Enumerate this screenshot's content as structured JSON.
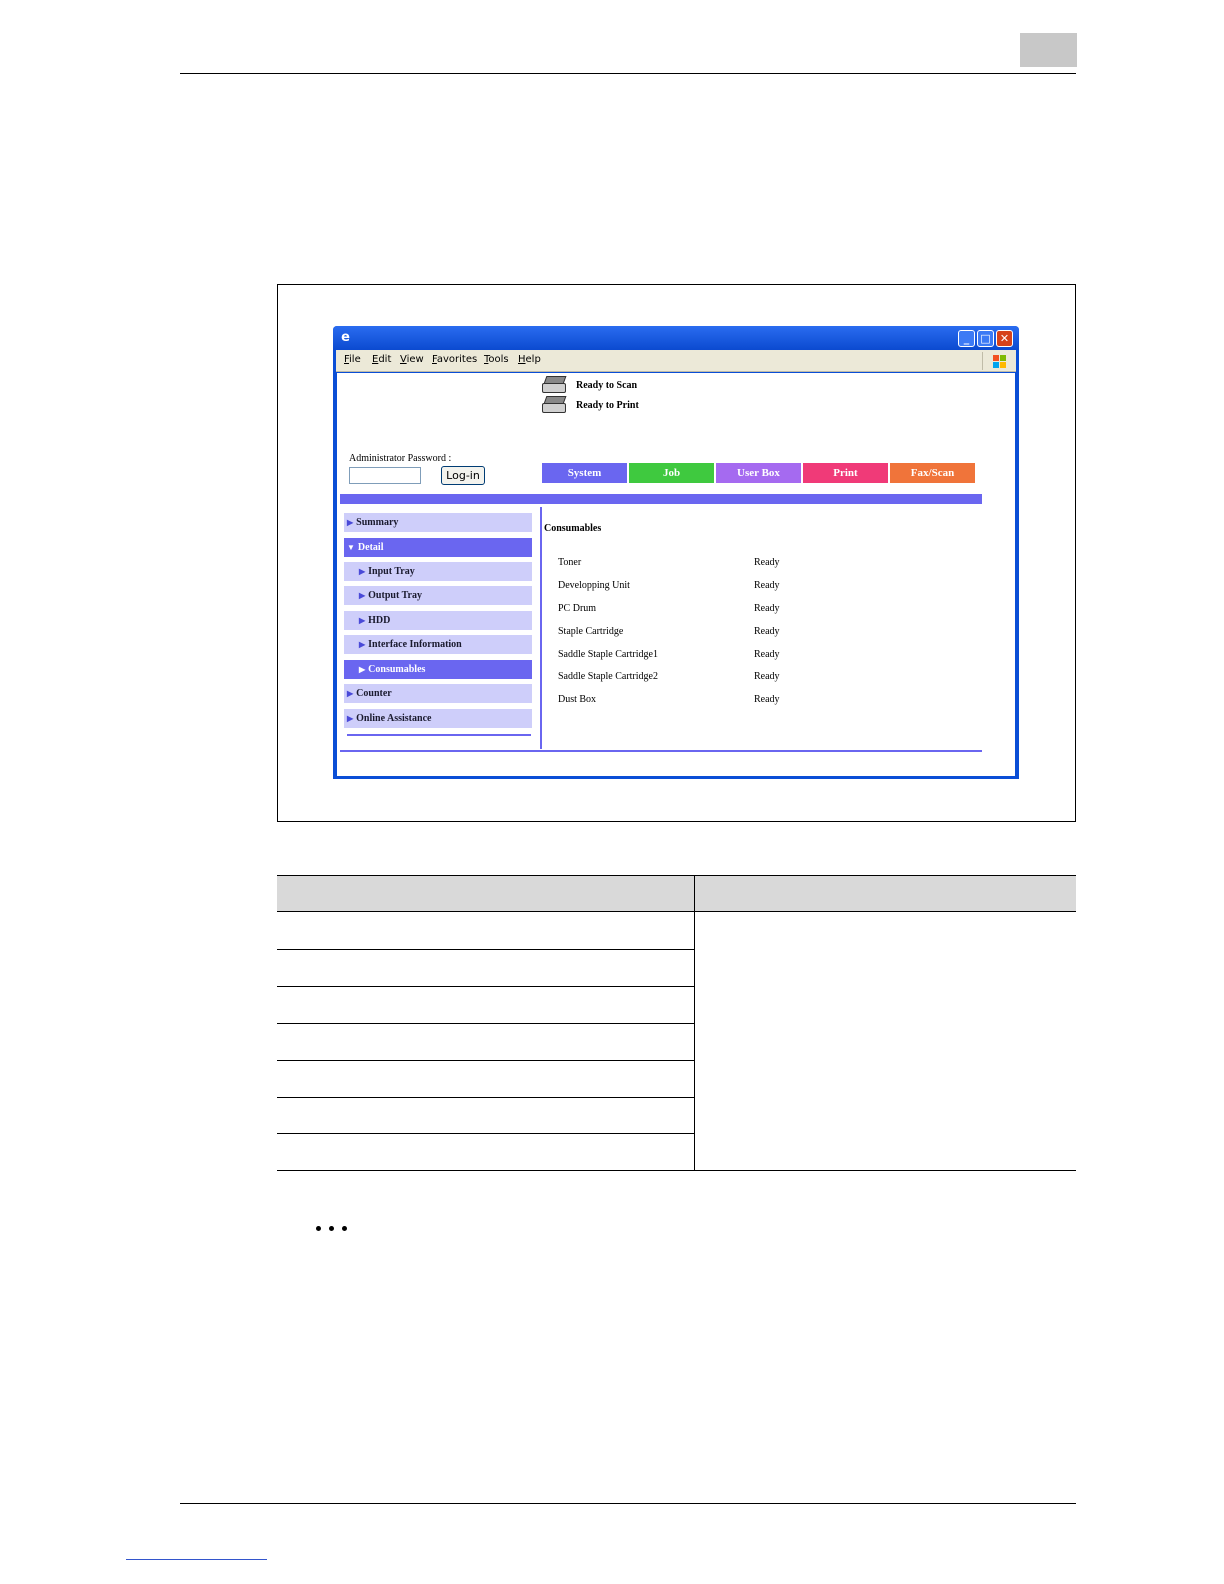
{
  "browser": {
    "menu": [
      "File",
      "Edit",
      "View",
      "Favorites",
      "Tools",
      "Help"
    ],
    "window_buttons": {
      "minimize": "_",
      "maximize": "□",
      "close": "✕"
    }
  },
  "status": {
    "scan": "Ready to Scan",
    "print": "Ready to Print"
  },
  "login": {
    "label": "Administrator Password :",
    "button": "Log-in"
  },
  "tabs": [
    {
      "label": "System",
      "color": "#6a66f0"
    },
    {
      "label": "Job",
      "color": "#3fc93f"
    },
    {
      "label": "User Box",
      "color": "#a56af0"
    },
    {
      "label": "Print",
      "color": "#f03a78"
    },
    {
      "label": "Fax/Scan",
      "color": "#f0743a"
    }
  ],
  "nav": {
    "summary": "Summary",
    "detail": "Detail",
    "input_tray": "Input Tray",
    "output_tray": "Output Tray",
    "hdd": "HDD",
    "interface": "Interface Information",
    "consumables": "Consumables",
    "counter": "Counter",
    "online": "Online Assistance"
  },
  "consumables": {
    "title": "Consumables",
    "items": [
      {
        "name": "Toner",
        "status": "Ready"
      },
      {
        "name": "Developping Unit",
        "status": "Ready"
      },
      {
        "name": "PC Drum",
        "status": "Ready"
      },
      {
        "name": "Staple Cartridge",
        "status": "Ready"
      },
      {
        "name": "Saddle Staple Cartridge1",
        "status": "Ready"
      },
      {
        "name": "Saddle Staple Cartridge2",
        "status": "Ready"
      },
      {
        "name": "Dust Box",
        "status": "Ready"
      }
    ]
  },
  "colors": {
    "accent": "#6a66f0",
    "nav_bg": "#cecefa",
    "window_blue": "#0a4ed6"
  }
}
